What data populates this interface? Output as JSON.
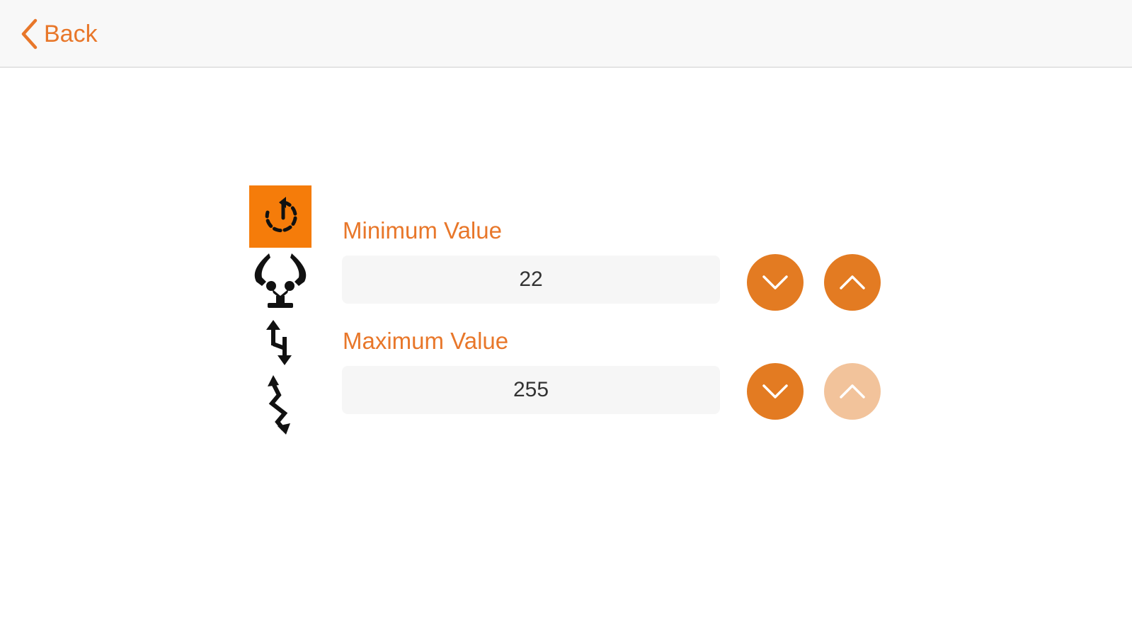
{
  "navbar": {
    "back_label": "Back"
  },
  "modes": [
    {
      "name": "rotate",
      "icon": "rotate-icon",
      "active": true
    },
    {
      "name": "gripper",
      "icon": "gripper-icon",
      "active": false
    },
    {
      "name": "lift",
      "icon": "up-down-arrows-icon",
      "active": false
    },
    {
      "name": "shake",
      "icon": "zigzag-arrows-icon",
      "active": false
    }
  ],
  "minimum": {
    "label": "Minimum Value",
    "value": "22",
    "decrease_icon": "chevron-down-icon",
    "increase_icon": "chevron-up-icon"
  },
  "maximum": {
    "label": "Maximum Value",
    "value": "255",
    "decrease_icon": "chevron-down-icon",
    "increase_icon": "chevron-up-icon",
    "increase_disabled": true
  },
  "colors": {
    "accent": "#e8772a",
    "active_mode_bg": "#f57c0a",
    "button": "#e37b22",
    "button_disabled": "#f2c39b",
    "field_bg": "#f6f6f6",
    "navbar_bg": "#f8f8f8"
  }
}
